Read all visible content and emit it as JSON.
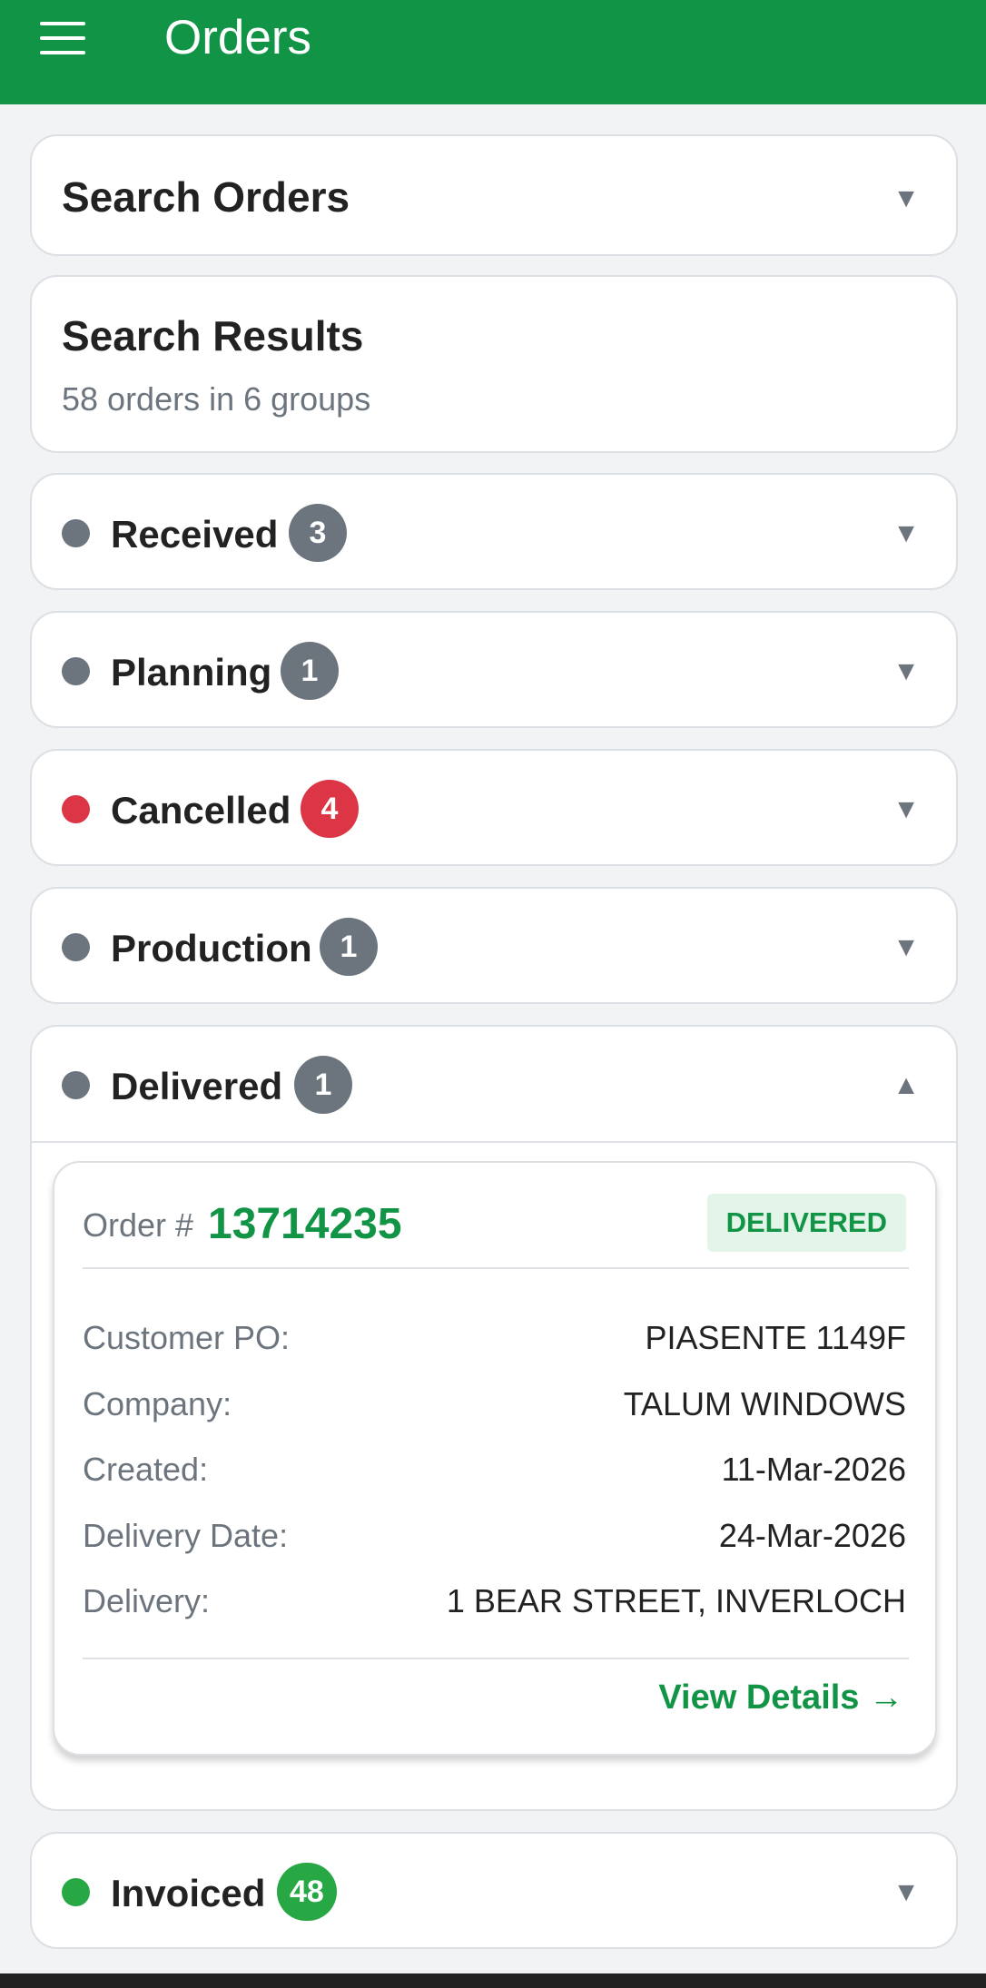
{
  "appbar": {
    "title": "Orders",
    "menu_icon": "hamburger-menu-icon"
  },
  "search": {
    "title": "Search Orders",
    "caret": "▼"
  },
  "results": {
    "title": "Search Results",
    "summary": "58 orders in 6 groups"
  },
  "groups": [
    {
      "name": "Received",
      "count": "3",
      "dot_color": "#6c757d",
      "badge_color": "#6c757d",
      "caret": "▼"
    },
    {
      "name": "Planning",
      "count": "1",
      "dot_color": "#6c757d",
      "badge_color": "#6c757d",
      "caret": "▼"
    },
    {
      "name": "Cancelled",
      "count": "4",
      "dot_color": "#dc3545",
      "badge_color": "#dc3545",
      "caret": "▼"
    },
    {
      "name": "Production",
      "count": "1",
      "dot_color": "#6c757d",
      "badge_color": "#6c757d",
      "caret": "▼"
    },
    {
      "name": "Delivered",
      "count": "1",
      "dot_color": "#6c757d",
      "badge_color": "#6c757d",
      "caret": "▲"
    },
    {
      "name": "Invoiced",
      "count": "48",
      "dot_color": "#28a745",
      "badge_color": "#28a745",
      "caret": "▼"
    }
  ],
  "order": {
    "label": "Order #",
    "number": "13714235",
    "status": "DELIVERED",
    "fields": [
      {
        "label": "Customer PO:",
        "value": "PIASENTE 1149F"
      },
      {
        "label": "Company:",
        "value": "TALUM WINDOWS"
      },
      {
        "label": "Created:",
        "value": "11-Mar-2026"
      },
      {
        "label": "Delivery Date:",
        "value": "24-Mar-2026"
      },
      {
        "label": "Delivery:",
        "value": "1 BEAR STREET, INVERLOCH"
      }
    ],
    "view_details": "View Details →"
  }
}
